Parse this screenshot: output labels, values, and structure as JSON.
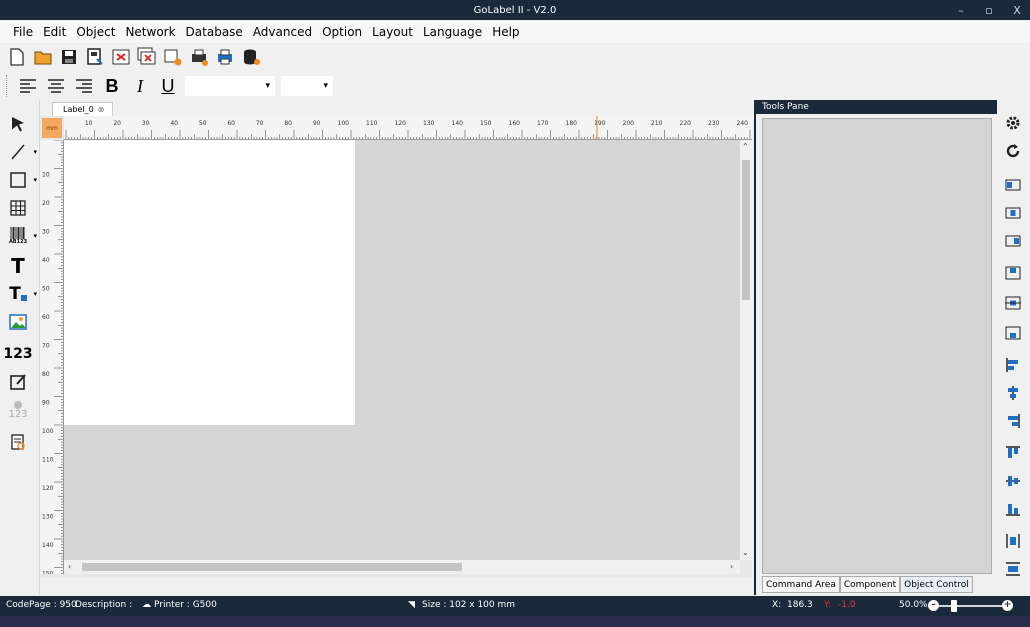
{
  "window": {
    "title": "GoLabel II - V2.0",
    "min": "–",
    "max": "▫",
    "close": "X"
  },
  "menu": [
    "File",
    "Edit",
    "Object",
    "Network",
    "Database",
    "Advanced",
    "Option",
    "Layout",
    "Language",
    "Help"
  ],
  "toolbar": {
    "icons": [
      "new-file-icon",
      "open-folder-icon",
      "save-icon",
      "save-as-icon",
      "close-label-icon",
      "close-all-icon",
      "label-setup-icon",
      "print-setup-icon",
      "print-icon",
      "database-icon"
    ],
    "format": {
      "bold": "B",
      "italic": "I",
      "underline": "U"
    },
    "font_name": "",
    "font_size": ""
  },
  "left_tools": [
    "select-arrow-icon",
    "line-icon",
    "rectangle-icon",
    "table-icon",
    "barcode-icon",
    "text-icon",
    "text-box-icon",
    "image-icon",
    "counter-icon",
    "edit-icon",
    "variable-icon",
    "document-search-icon"
  ],
  "left_tool_text": {
    "counter": "123",
    "barcode": "AB123",
    "variable": "123"
  },
  "document": {
    "tab_label": "Label_0",
    "unit": "mm"
  },
  "hruler_ticks": [
    "10",
    "20",
    "30",
    "40",
    "50",
    "60",
    "70",
    "80",
    "90",
    "100",
    "110",
    "120",
    "130",
    "140",
    "150",
    "160",
    "170",
    "180",
    "190",
    "200",
    "210",
    "220",
    "230",
    "240"
  ],
  "vruler_ticks": [
    "10",
    "20",
    "30",
    "40",
    "50",
    "60",
    "70",
    "80",
    "90",
    "100",
    "110",
    "120",
    "130",
    "140",
    "150"
  ],
  "tools_pane": {
    "title": "Tools Pane",
    "tabs": [
      "Command Area",
      "Component",
      "Object Control"
    ]
  },
  "right_tools": [
    "settings-gear-icon",
    "rotate-icon",
    "align-left-icon",
    "align-center-icon",
    "align-right-icon",
    "align-top-icon",
    "align-middle-icon",
    "align-bottom-icon",
    "distribute-left-icon",
    "distribute-center-icon",
    "distribute-right-icon",
    "distribute-top-icon",
    "distribute-middle-icon",
    "distribute-bottom-icon",
    "space-horizontal-icon",
    "space-vertical-icon"
  ],
  "status": {
    "codepage": "CodePage : 950",
    "description": "Description :",
    "printer": "Printer : G500",
    "size": "Size : 102 x 100 mm",
    "x_label": "X:",
    "x_value": "186.3",
    "y_label": "Y:",
    "y_value": "-1.0",
    "zoom": "50.0%",
    "zoom_fraction": 0.3
  },
  "colors": {
    "title_bar": "#1a2a3a",
    "unit_badge": "#f4a860",
    "canvas": "#d6d6d6",
    "accent_blue": "#1f6fc4",
    "accent_orange": "#f08a1e"
  }
}
